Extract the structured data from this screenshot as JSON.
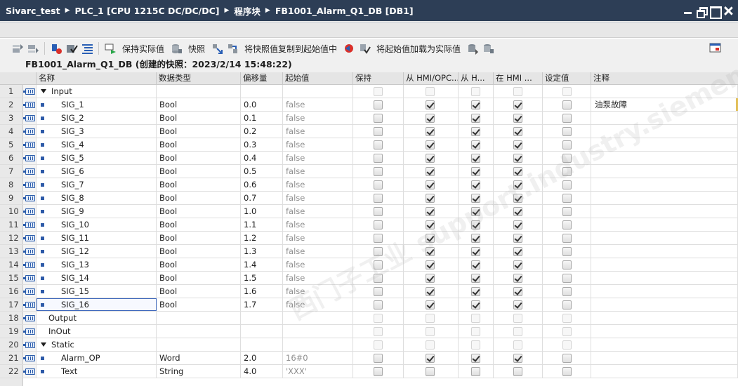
{
  "breadcrumb": [
    "Sivarc_test",
    "PLC_1 [CPU 1215C DC/DC/DC]",
    "程序块",
    "FB1001_Alarm_Q1_DB [DB1]"
  ],
  "toolbar": {
    "keep_actual": "保持实际值",
    "snapshot": "快照",
    "copy_snapshot": "将快照值复制到起始值中",
    "load_start": "将起始值加载为实际值"
  },
  "db_header": "FB1001_Alarm_Q1_DB (创建的快照：2023/2/14 15:48:22)",
  "columns": {
    "name": "名称",
    "type": "数据类型",
    "offset": "偏移量",
    "initial": "起始值",
    "retain": "保持",
    "hmi_opc": "从 HMI/OPC...",
    "hmi_h": "从 H...",
    "in_hmi": "在 HMI ...",
    "setpoint": "设定值",
    "comment": "注释"
  },
  "watermark": "西门子工业 support.industry.siemens.com/cs",
  "rows": [
    {
      "num": "1",
      "kind": "section",
      "name": "Input",
      "expanded": true,
      "type": "",
      "offset": "",
      "initial": "",
      "retain": false,
      "hmi1": false,
      "hmi2": false,
      "hmi3": false,
      "set": false,
      "comment": "",
      "active": false
    },
    {
      "num": "2",
      "kind": "var",
      "name": "SIG_1",
      "type": "Bool",
      "offset": "0.0",
      "initial": "false",
      "retain": false,
      "hmi1": true,
      "hmi2": true,
      "hmi3": true,
      "set": false,
      "comment": "油泵故障",
      "active": true
    },
    {
      "num": "3",
      "kind": "var",
      "name": "SIG_2",
      "type": "Bool",
      "offset": "0.1",
      "initial": "false",
      "retain": false,
      "hmi1": true,
      "hmi2": true,
      "hmi3": true,
      "set": false,
      "comment": "",
      "active": true
    },
    {
      "num": "4",
      "kind": "var",
      "name": "SIG_3",
      "type": "Bool",
      "offset": "0.2",
      "initial": "false",
      "retain": false,
      "hmi1": true,
      "hmi2": true,
      "hmi3": true,
      "set": false,
      "comment": "",
      "active": true
    },
    {
      "num": "5",
      "kind": "var",
      "name": "SIG_4",
      "type": "Bool",
      "offset": "0.3",
      "initial": "false",
      "retain": false,
      "hmi1": true,
      "hmi2": true,
      "hmi3": true,
      "set": false,
      "comment": "",
      "active": true
    },
    {
      "num": "6",
      "kind": "var",
      "name": "SIG_5",
      "type": "Bool",
      "offset": "0.4",
      "initial": "false",
      "retain": false,
      "hmi1": true,
      "hmi2": true,
      "hmi3": true,
      "set": false,
      "comment": "",
      "active": true
    },
    {
      "num": "7",
      "kind": "var",
      "name": "SIG_6",
      "type": "Bool",
      "offset": "0.5",
      "initial": "false",
      "retain": false,
      "hmi1": true,
      "hmi2": true,
      "hmi3": true,
      "set": false,
      "comment": "",
      "active": true
    },
    {
      "num": "8",
      "kind": "var",
      "name": "SIG_7",
      "type": "Bool",
      "offset": "0.6",
      "initial": "false",
      "retain": false,
      "hmi1": true,
      "hmi2": true,
      "hmi3": true,
      "set": false,
      "comment": "",
      "active": true
    },
    {
      "num": "9",
      "kind": "var",
      "name": "SIG_8",
      "type": "Bool",
      "offset": "0.7",
      "initial": "false",
      "retain": false,
      "hmi1": true,
      "hmi2": true,
      "hmi3": true,
      "set": false,
      "comment": "",
      "active": true
    },
    {
      "num": "10",
      "kind": "var",
      "name": "SIG_9",
      "type": "Bool",
      "offset": "1.0",
      "initial": "false",
      "retain": false,
      "hmi1": true,
      "hmi2": true,
      "hmi3": true,
      "set": false,
      "comment": "",
      "active": true
    },
    {
      "num": "11",
      "kind": "var",
      "name": "SIG_10",
      "type": "Bool",
      "offset": "1.1",
      "initial": "false",
      "retain": false,
      "hmi1": true,
      "hmi2": true,
      "hmi3": true,
      "set": false,
      "comment": "",
      "active": true
    },
    {
      "num": "12",
      "kind": "var",
      "name": "SIG_11",
      "type": "Bool",
      "offset": "1.2",
      "initial": "false",
      "retain": false,
      "hmi1": true,
      "hmi2": true,
      "hmi3": true,
      "set": false,
      "comment": "",
      "active": true
    },
    {
      "num": "13",
      "kind": "var",
      "name": "SIG_12",
      "type": "Bool",
      "offset": "1.3",
      "initial": "false",
      "retain": false,
      "hmi1": true,
      "hmi2": true,
      "hmi3": true,
      "set": false,
      "comment": "",
      "active": true
    },
    {
      "num": "14",
      "kind": "var",
      "name": "SIG_13",
      "type": "Bool",
      "offset": "1.4",
      "initial": "false",
      "retain": false,
      "hmi1": true,
      "hmi2": true,
      "hmi3": true,
      "set": false,
      "comment": "",
      "active": true
    },
    {
      "num": "15",
      "kind": "var",
      "name": "SIG_14",
      "type": "Bool",
      "offset": "1.5",
      "initial": "false",
      "retain": false,
      "hmi1": true,
      "hmi2": true,
      "hmi3": true,
      "set": false,
      "comment": "",
      "active": true
    },
    {
      "num": "16",
      "kind": "var",
      "name": "SIG_15",
      "type": "Bool",
      "offset": "1.6",
      "initial": "false",
      "retain": false,
      "hmi1": true,
      "hmi2": true,
      "hmi3": true,
      "set": false,
      "comment": "",
      "active": true
    },
    {
      "num": "17",
      "kind": "var",
      "name": "SIG_16",
      "type": "Bool",
      "offset": "1.7",
      "initial": "false",
      "retain": false,
      "hmi1": true,
      "hmi2": true,
      "hmi3": true,
      "set": false,
      "comment": "",
      "active": true,
      "selected": true
    },
    {
      "num": "18",
      "kind": "section",
      "name": "Output",
      "expanded": false,
      "type": "",
      "offset": "",
      "initial": "",
      "retain": false,
      "hmi1": false,
      "hmi2": false,
      "hmi3": false,
      "set": false,
      "comment": "",
      "active": false
    },
    {
      "num": "19",
      "kind": "section",
      "name": "InOut",
      "expanded": false,
      "type": "",
      "offset": "",
      "initial": "",
      "retain": false,
      "hmi1": false,
      "hmi2": false,
      "hmi3": false,
      "set": false,
      "comment": "",
      "active": false
    },
    {
      "num": "20",
      "kind": "section",
      "name": "Static",
      "expanded": true,
      "type": "",
      "offset": "",
      "initial": "",
      "retain": false,
      "hmi1": false,
      "hmi2": false,
      "hmi3": false,
      "set": false,
      "comment": "",
      "active": false
    },
    {
      "num": "21",
      "kind": "var",
      "name": "Alarm_OP",
      "type": "Word",
      "offset": "2.0",
      "initial": "16#0",
      "retain": false,
      "hmi1": true,
      "hmi2": true,
      "hmi3": true,
      "set": false,
      "comment": "",
      "active": true
    },
    {
      "num": "22",
      "kind": "var",
      "name": "Text",
      "type": "String",
      "offset": "4.0",
      "initial": "'XXX'",
      "retain": false,
      "hmi1": false,
      "hmi2": false,
      "hmi3": false,
      "set": false,
      "comment": "",
      "active": true
    }
  ]
}
